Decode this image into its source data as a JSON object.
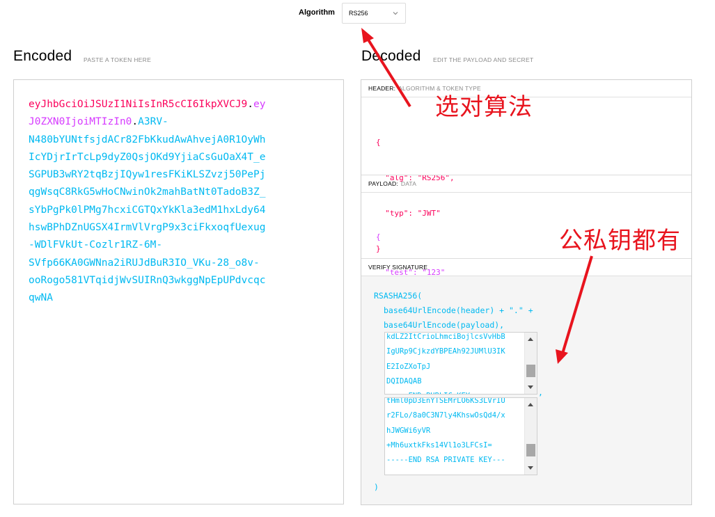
{
  "algorithm": {
    "label": "Algorithm",
    "selected": "RS256"
  },
  "encoded": {
    "title": "Encoded",
    "subtitle": "PASTE A TOKEN HERE",
    "lines": [
      [
        {
          "t": "eyJhbGciOiJSUzI1NiIsInR5cCI6IkpXVCJ9",
          "c": "hdr"
        },
        {
          "t": ".",
          "c": "dot"
        },
        {
          "t": "ey",
          "c": "pay"
        }
      ],
      [
        {
          "t": "J0ZXN0IjoiMTIzIn0",
          "c": "pay"
        },
        {
          "t": ".",
          "c": "dot"
        },
        {
          "t": "A3RV-",
          "c": "sig"
        }
      ],
      [
        {
          "t": "N480bYUNtfsjdACr82FbKkudAwAhvejA0R1OyWh",
          "c": "sig"
        }
      ],
      [
        {
          "t": "IcYDjrIrTcLp9dyZ0QsjOKd9YjiaCsGuOaX4T_e",
          "c": "sig"
        }
      ],
      [
        {
          "t": "SGPUB3wRY2tqBzjIQyw1resFKiKLSZvzj50PePj",
          "c": "sig"
        }
      ],
      [
        {
          "t": "qgWsqC8RkG5wHoCNwinOk2mahBatNt0TadoB3Z_",
          "c": "sig"
        }
      ],
      [
        {
          "t": "sYbPgPk0lPMg7hcxiCGTQxYkKla3edM1hxLdy64",
          "c": "sig"
        }
      ],
      [
        {
          "t": "hswBPhDZnUGSX4IrmVlVrgP9x3ciFkxoqfUexug",
          "c": "sig"
        }
      ],
      [
        {
          "t": "-WDlFVkUt-Cozlr1RZ-6M-",
          "c": "sig"
        }
      ],
      [
        {
          "t": "SVfp66KA0GWNna2iRUJdBuR3IO_VKu-28_o8v-",
          "c": "sig"
        }
      ],
      [
        {
          "t": "ooRogo581VTqidjWvSUIRnQ3wkggNpEpUPdvcqc",
          "c": "sig"
        }
      ],
      [
        {
          "t": "qwNA",
          "c": "sig"
        }
      ]
    ]
  },
  "decoded": {
    "title": "Decoded",
    "subtitle": "EDIT THE PAYLOAD AND SECRET",
    "header_panel": {
      "label": "HEADER:",
      "sub": "ALGORITHM & TOKEN TYPE"
    },
    "header_json": {
      "open": "{",
      "alg_key": "\"alg\"",
      "alg_val": "\"RS256\"",
      "typ_key": "\"typ\"",
      "typ_val": "\"JWT\"",
      "close": "}"
    },
    "payload_panel": {
      "label": "PAYLOAD:",
      "sub": "DATA"
    },
    "payload_json": {
      "open": "{",
      "test_key": "\"test\"",
      "test_val": "\"123\"",
      "close": "}"
    },
    "signature_panel": {
      "label": "VERIFY SIGNATURE"
    },
    "signature": {
      "fn": "RSASHA256(",
      "line1": "base64UrlEncode(header) + \".\" +",
      "line2": "base64UrlEncode(payload),",
      "comma": ",",
      "close": ")",
      "public_key_lines": [
        "kdLZ2ItCrioLhmciBojlcsVvHbB",
        "IgURp9CjkzdYBPEAh92JUMlU3IK",
        "E2IoZXoTpJ",
        "DQIDAQAB",
        "-----END PUBLIC KEY-----"
      ],
      "private_key_lines": [
        "tHml0pD3EnYTSEMrLO6KS3LVrIU",
        "r2FLo/8a0C3N7ly4KhswOsQd4/x",
        "hJWGWi6yVR",
        "+Mh6uxtkFks14Vl1o3LFCsI=",
        "-----END RSA PRIVATE KEY---"
      ]
    }
  },
  "annotations": {
    "select_algo": "选对算法",
    "both_keys": "公私钥都有"
  },
  "colors": {
    "header": "#fb015b",
    "payload": "#d63aff",
    "signature": "#00b9f1",
    "annotation": "#e8141e"
  }
}
